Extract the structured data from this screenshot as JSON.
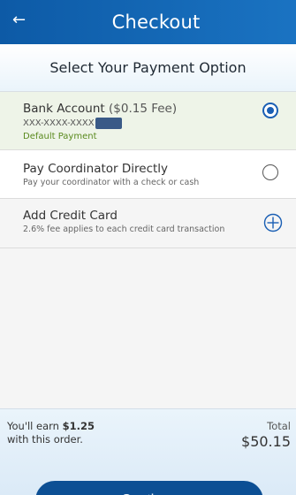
{
  "header": {
    "title": "Checkout",
    "back_icon": "arrow-left-icon"
  },
  "subheader": {
    "title": "Select Your Payment Option"
  },
  "options": {
    "bank": {
      "title": "Bank Account",
      "fee": "($0.15 Fee)",
      "masked_number": "XXX-XXXX-XXXX",
      "default_label": "Default Payment",
      "selected": true
    },
    "coordinator": {
      "title": "Pay Coordinator Directly",
      "subtitle": "Pay your coordinator with a check or cash",
      "selected": false
    },
    "credit_card": {
      "title": "Add Credit Card",
      "subtitle": "2.6% fee applies to each credit card transaction",
      "icon": "add-circle-icon"
    }
  },
  "footer": {
    "earn_prefix": "You'll earn",
    "earn_amount": "$1.25",
    "earn_suffix": "with this order.",
    "total_label": "Total",
    "total_value": "$50.15",
    "continue_label": "Continue"
  },
  "colors": {
    "header_blue": "#0d5aa6",
    "selected_bg": "#eef4e8",
    "default_green": "#5a8a1e",
    "button_blue": "#0c4f94"
  }
}
